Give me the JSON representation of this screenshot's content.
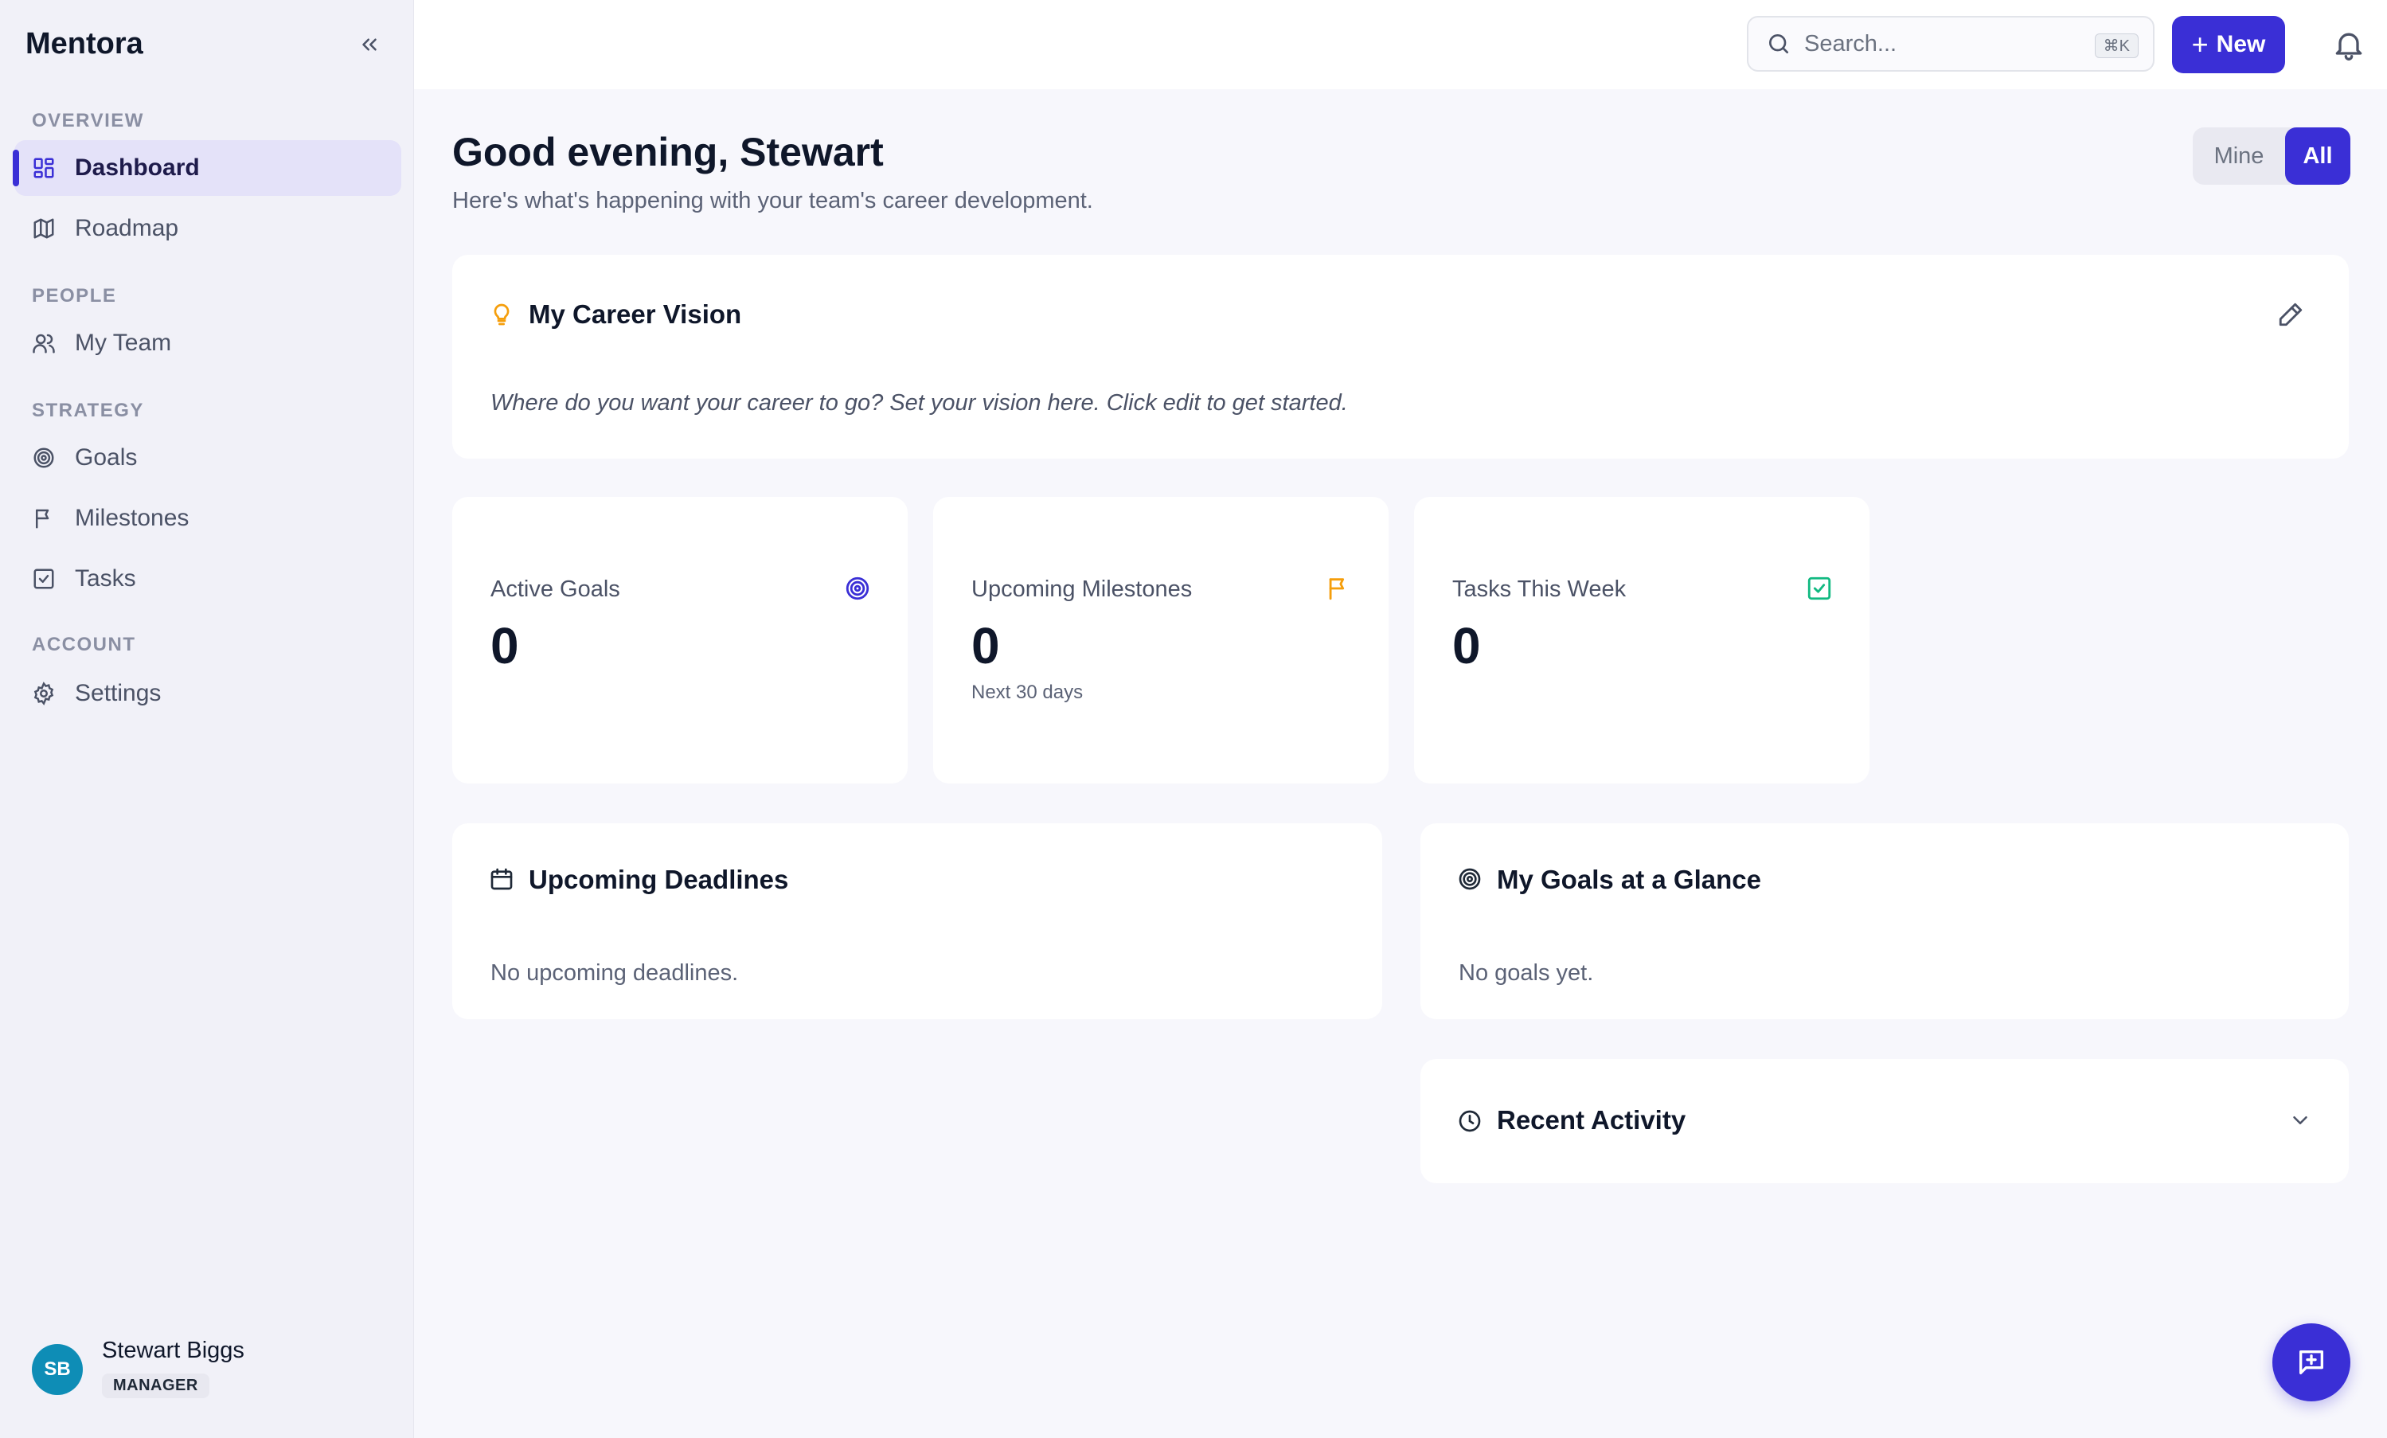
{
  "app": {
    "brand": "Mentora"
  },
  "sidebar": {
    "sections": [
      {
        "label": "OVERVIEW"
      },
      {
        "label": "PEOPLE"
      },
      {
        "label": "STRATEGY"
      },
      {
        "label": "ACCOUNT"
      }
    ],
    "items": [
      {
        "label": "Dashboard",
        "icon": "layout-grid-icon",
        "active": true
      },
      {
        "label": "Roadmap",
        "icon": "map-icon"
      },
      {
        "label": "My Team",
        "icon": "users-icon"
      },
      {
        "label": "Goals",
        "icon": "target-icon"
      },
      {
        "label": "Milestones",
        "icon": "flag-icon"
      },
      {
        "label": "Tasks",
        "icon": "check-square-icon"
      },
      {
        "label": "Settings",
        "icon": "gear-icon"
      }
    ],
    "user": {
      "initials": "SB",
      "name": "Stewart Biggs",
      "role": "MANAGER"
    }
  },
  "topbar": {
    "search": {
      "placeholder": "Search...",
      "shortcut": "⌘K"
    },
    "new_button": "New"
  },
  "header": {
    "greeting": "Good evening, Stewart",
    "subtitle": "Here's what's happening with your team's career development.",
    "toggle": {
      "mine": "Mine",
      "all": "All",
      "selected": "All"
    }
  },
  "vision": {
    "title": "My Career Vision",
    "placeholder_text": "Where do you want your career to go? Set your vision here. Click edit to get started."
  },
  "stats": [
    {
      "label": "Active Goals",
      "value": "0",
      "hint": "",
      "color": "#3a2fd6"
    },
    {
      "label": "Upcoming Milestones",
      "value": "0",
      "hint": "Next 30 days",
      "color": "#f59e0b"
    },
    {
      "label": "Tasks This Week",
      "value": "0",
      "hint": "",
      "color": "#10b981"
    }
  ],
  "deadlines": {
    "title": "Upcoming Deadlines",
    "empty": "No upcoming deadlines."
  },
  "goals_glance": {
    "title": "My Goals at a Glance",
    "empty": "No goals yet."
  },
  "recent_activity": {
    "title": "Recent Activity"
  },
  "colors": {
    "accent": "#3a2fd6",
    "avatar": "#0e8db6"
  }
}
